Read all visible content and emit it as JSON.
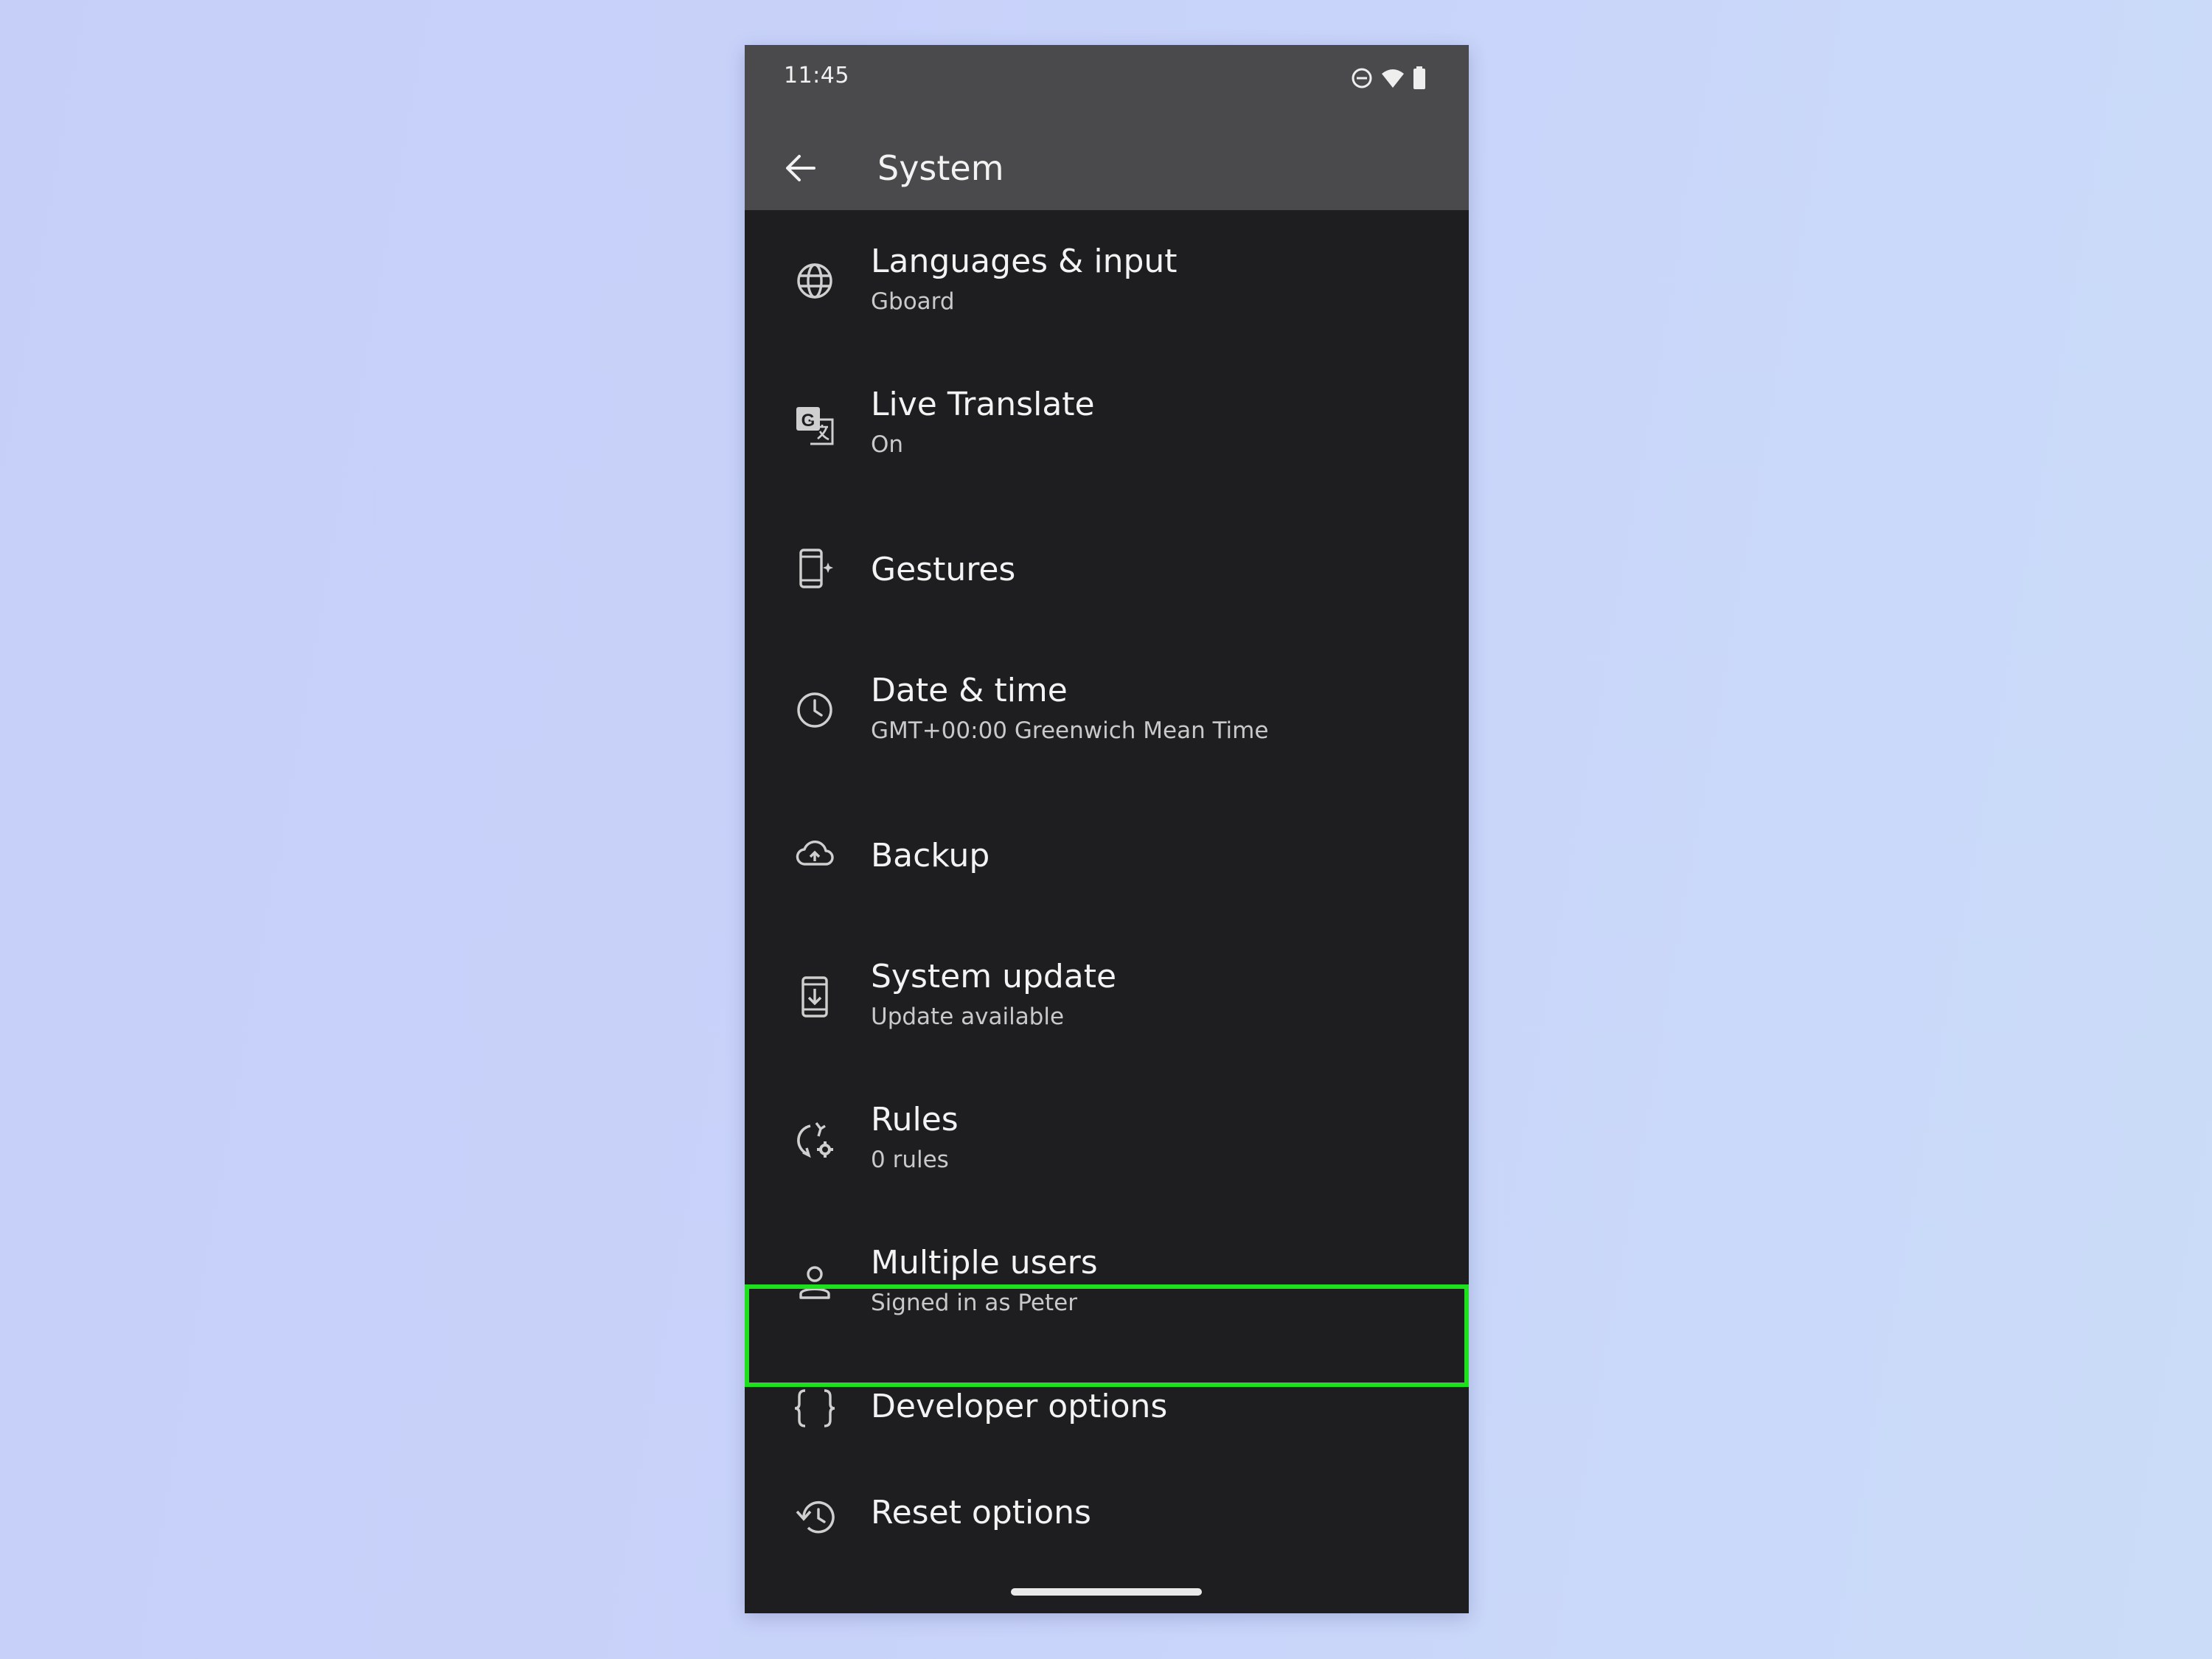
{
  "status_bar": {
    "time": "11:45"
  },
  "app_bar": {
    "title": "System"
  },
  "items": [
    {
      "title": "Languages & input",
      "subtitle": "Gboard"
    },
    {
      "title": "Live Translate",
      "subtitle": "On"
    },
    {
      "title": "Gestures",
      "subtitle": ""
    },
    {
      "title": "Date & time",
      "subtitle": "GMT+00:00 Greenwich Mean Time"
    },
    {
      "title": "Backup",
      "subtitle": ""
    },
    {
      "title": "System update",
      "subtitle": "Update available"
    },
    {
      "title": "Rules",
      "subtitle": "0 rules"
    },
    {
      "title": "Multiple users",
      "subtitle": "Signed in as Peter"
    },
    {
      "title": "Developer options",
      "subtitle": ""
    },
    {
      "title": "Reset options",
      "subtitle": ""
    }
  ],
  "icons": [
    "globe-icon",
    "translate-icon",
    "gestures-phone-icon",
    "clock-icon",
    "cloud-upload-icon",
    "system-update-icon",
    "rules-icon",
    "person-icon",
    "code-braces-icon",
    "history-icon"
  ],
  "colors": {
    "highlight": "#1fe01f",
    "app_bar": "#4a4a4c",
    "background": "#1e1e20"
  }
}
